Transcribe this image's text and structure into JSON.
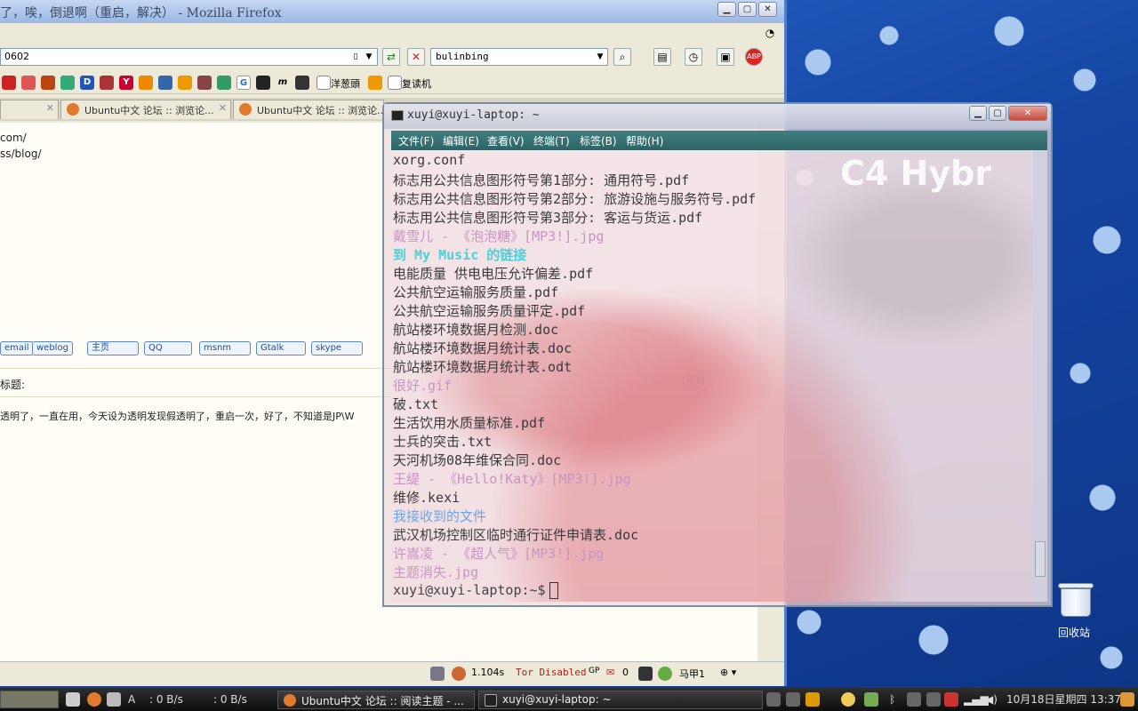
{
  "firefox": {
    "title": "了，唉，倒退啊（重启，解决） - Mozilla Firefox",
    "url": "0602",
    "search_text": "bulinbing",
    "bookmarks": [
      {
        "label": "洋葱頭"
      },
      {
        "label": "复读机"
      }
    ],
    "tabs": [
      {
        "label": "Ubuntu中文 论坛 :: 浏览论..."
      },
      {
        "label": "Ubuntu中文 论坛 :: 浏览论..."
      }
    ],
    "page": {
      "line1": "com/",
      "line2": "ss/blog/",
      "contact_buttons": [
        "email",
        "weblog",
        "主页",
        "QQ",
        "msnm",
        "Gtalk",
        "skype"
      ],
      "subject_label": "标题:",
      "post_text": "透明了，一直在用，今天设为透明发现假透明了，重启一次，好了，不知道是JP\\W",
      "quote_button": "引用"
    },
    "status": {
      "speed": "1.104s",
      "tor": "Tor Disabled",
      "gp": "GP",
      "mail_count": "0",
      "user": "马甲1"
    }
  },
  "terminal": {
    "title": "xuyi@xuyi-laptop: ~",
    "menu": [
      "文件(F)",
      "编辑(E)",
      "查看(V)",
      "终端(T)",
      "标签(B)",
      "帮助(H)"
    ],
    "bg_text": "C4 Hybr",
    "lines": [
      {
        "text": "xorg.conf",
        "kind": "file"
      },
      {
        "text": "标志用公共信息图形符号第1部分: 通用符号.pdf",
        "kind": "file"
      },
      {
        "text": "标志用公共信息图形符号第2部分: 旅游设施与服务符号.pdf",
        "kind": "file"
      },
      {
        "text": "标志用公共信息图形符号第3部分: 客运与货运.pdf",
        "kind": "file"
      },
      {
        "text": "戴雪儿 - 《泡泡糖》[MP3!].jpg",
        "kind": "media"
      },
      {
        "text": "到 My Music 的链接",
        "kind": "link"
      },
      {
        "text": "电能质量 供电电压允许偏差.pdf",
        "kind": "file"
      },
      {
        "text": "公共航空运输服务质量.pdf",
        "kind": "file"
      },
      {
        "text": "公共航空运输服务质量评定.pdf",
        "kind": "file"
      },
      {
        "text": "航站楼环境数据月检测.doc",
        "kind": "file"
      },
      {
        "text": "航站楼环境数据月统计表.doc",
        "kind": "file"
      },
      {
        "text": "航站楼环境数据月统计表.odt",
        "kind": "file"
      },
      {
        "text": "很好.gif",
        "kind": "media"
      },
      {
        "text": "破.txt",
        "kind": "file"
      },
      {
        "text": "生活饮用水质量标准.pdf",
        "kind": "file"
      },
      {
        "text": "士兵的突击.txt",
        "kind": "file"
      },
      {
        "text": "天河机场08年维保合同.doc",
        "kind": "file"
      },
      {
        "text": "王缇 - 《Hello!Katy》[MP3!].jpg",
        "kind": "media"
      },
      {
        "text": "维修.kexi",
        "kind": "file"
      },
      {
        "text": "我接收到的文件",
        "kind": "dir"
      },
      {
        "text": "武汉机场控制区临时通行证件申请表.doc",
        "kind": "file"
      },
      {
        "text": "许嵩凌 - 《超人气》[MP3!].jpg",
        "kind": "media"
      },
      {
        "text": "主题消失.jpg",
        "kind": "media"
      }
    ],
    "prompt": "xuyi@xuyi-laptop:~$"
  },
  "desktop": {
    "trash_label": "回收站"
  },
  "taskbar": {
    "net_down": ": 0 B/s",
    "net_up": ": 0 B/s",
    "tasks": [
      {
        "label": "Ubuntu中文 论坛 :: 阅读主题 - ..."
      },
      {
        "label": "xuyi@xuyi-laptop: ~"
      }
    ],
    "clock": "10月18日星期四 13:37"
  },
  "colors": {
    "terminal_menu": "#2f6366",
    "terminal_file": "#3a3a3a",
    "terminal_media": "#c994c3",
    "terminal_link": "#4fd0d8",
    "terminal_dir": "#6ca6ea",
    "tor_text": "#b0221a"
  }
}
